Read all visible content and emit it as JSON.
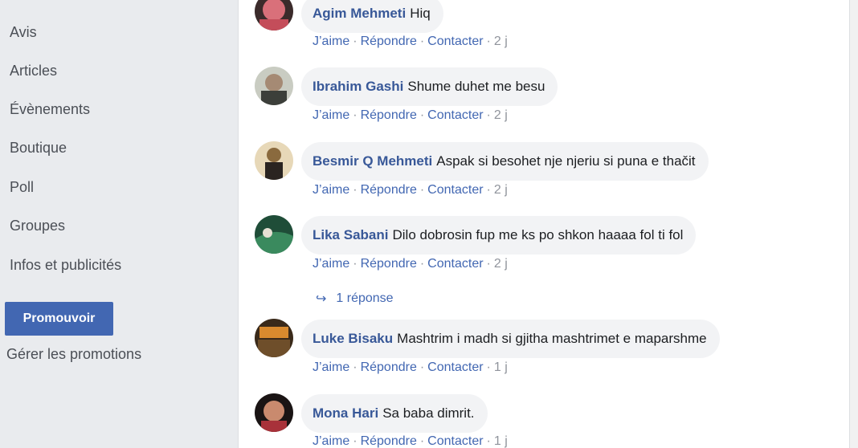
{
  "sidebar": {
    "items": [
      {
        "label": "Avis"
      },
      {
        "label": "Articles"
      },
      {
        "label": "Évènements"
      },
      {
        "label": "Boutique"
      },
      {
        "label": "Poll"
      },
      {
        "label": "Groupes"
      },
      {
        "label": "Infos et publicités"
      }
    ],
    "promote_label": "Promouvoir",
    "manage_label": "Gérer les promotions"
  },
  "actions": {
    "like": "J’aime",
    "reply": "Répondre",
    "contact": "Contacter"
  },
  "comments": [
    {
      "author": "Agim Mehmeti",
      "text": "Hiq",
      "time": "2 j",
      "avatar_color": "#c44d5a"
    },
    {
      "author": "Ibrahim Gashi",
      "text": "Shume duhet me besu",
      "time": "2 j",
      "avatar_color": "#6b6f5e"
    },
    {
      "author": "Besmir Q Mehmeti",
      "text": "Aspak si besohet nje njeriu si puna e thačit",
      "time": "2 j",
      "avatar_color": "#8a6a3e"
    },
    {
      "author": "Lika Sabani",
      "text": "Dilo dobrosin fup me ks po shkon haaaa fol ti fol",
      "time": "2 j",
      "avatar_color": "#2e6b4a"
    },
    {
      "author": "Luke Bisaku",
      "text": "Mashtrim i madh si gjitha mashtrimet e maparshme",
      "time": "1 j",
      "avatar_color": "#7a5a2e"
    },
    {
      "author": "Mona Hari",
      "text": "Sa baba dimrit.",
      "time": "1 j",
      "avatar_color": "#a8323a"
    }
  ],
  "replies_link": "1 réponse"
}
